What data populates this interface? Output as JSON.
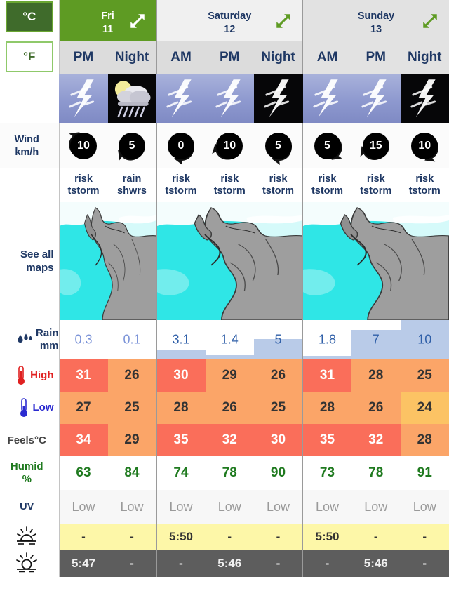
{
  "units": {
    "celsius": "°C",
    "fahrenheit": "°F",
    "selected": "°C"
  },
  "labels": {
    "wind": "Wind",
    "wind_unit": "km/h",
    "see_all": "See all",
    "maps": "maps",
    "rain": "Rain",
    "rain_unit": "mm",
    "high": "High",
    "low": "Low",
    "feels": "Feels°C",
    "humid": "Humid",
    "humid_unit": "%",
    "uv": "UV"
  },
  "days": [
    {
      "name": "Fri",
      "num": "11",
      "today": true,
      "periods": [
        "PM",
        "Night"
      ]
    },
    {
      "name": "Saturday",
      "num": "12",
      "today": false,
      "periods": [
        "AM",
        "PM",
        "Night"
      ]
    },
    {
      "name": "Sunday",
      "num": "13",
      "today": false,
      "periods": [
        "AM",
        "PM",
        "Night"
      ]
    }
  ],
  "columns": [
    {
      "day": 0,
      "period": "PM",
      "icon": "day-thunderstorm",
      "wind": "10",
      "wind_dir": 225,
      "risk": [
        "risk",
        "tstorm"
      ],
      "rain": "0.3",
      "rain_bar": 0,
      "high": "31",
      "high_class": "t-hot",
      "low": "27",
      "low_class": "t-warm",
      "feels": "34",
      "feels_class": "t-hot",
      "humid": "63",
      "uv": "Low",
      "sunrise": "-",
      "sunset": "5:47"
    },
    {
      "day": 0,
      "period": "Night",
      "icon": "night-rain",
      "wind": "5",
      "wind_dir": 135,
      "risk": [
        "rain",
        "shwrs"
      ],
      "rain": "0.1",
      "rain_bar": 0,
      "high": "26",
      "high_class": "t-warm",
      "low": "25",
      "low_class": "t-warm",
      "feels": "29",
      "feels_class": "t-warm",
      "humid": "84",
      "uv": "Low",
      "sunrise": "-",
      "sunset": "-"
    },
    {
      "day": 1,
      "period": "AM",
      "icon": "day-thunderstorm",
      "wind": "0",
      "wind_dir": 90,
      "risk": [
        "risk",
        "tstorm"
      ],
      "rain": "3.1",
      "rain_bar": 13,
      "high": "30",
      "high_class": "t-hot",
      "low": "28",
      "low_class": "t-warm",
      "feels": "35",
      "feels_class": "t-hot",
      "humid": "74",
      "uv": "Low",
      "sunrise": "5:50",
      "sunset": "-"
    },
    {
      "day": 1,
      "period": "PM",
      "icon": "day-thunderstorm",
      "wind": "10",
      "wind_dir": 160,
      "risk": [
        "risk",
        "tstorm"
      ],
      "rain": "1.4",
      "rain_bar": 6,
      "high": "29",
      "high_class": "t-warm",
      "low": "26",
      "low_class": "t-warm",
      "feels": "32",
      "feels_class": "t-hot",
      "humid": "78",
      "uv": "Low",
      "sunrise": "-",
      "sunset": "5:46"
    },
    {
      "day": 1,
      "period": "Night",
      "icon": "night-thunderstorm",
      "wind": "5",
      "wind_dir": 90,
      "risk": [
        "risk",
        "tstorm"
      ],
      "rain": "5",
      "rain_bar": 29,
      "high": "26",
      "high_class": "t-warm",
      "low": "25",
      "low_class": "t-warm",
      "feels": "30",
      "feels_class": "t-hot",
      "humid": "90",
      "uv": "Low",
      "sunrise": "-",
      "sunset": "-"
    },
    {
      "day": 2,
      "period": "AM",
      "icon": "day-thunderstorm",
      "wind": "5",
      "wind_dir": 45,
      "risk": [
        "risk",
        "tstorm"
      ],
      "rain": "1.8",
      "rain_bar": 5,
      "high": "31",
      "high_class": "t-hot",
      "low": "28",
      "low_class": "t-warm",
      "feels": "35",
      "feels_class": "t-hot",
      "humid": "73",
      "uv": "Low",
      "sunrise": "5:50",
      "sunset": "-"
    },
    {
      "day": 2,
      "period": "PM",
      "icon": "day-thunderstorm",
      "wind": "15",
      "wind_dir": 150,
      "risk": [
        "risk",
        "tstorm"
      ],
      "rain": "7",
      "rain_bar": 42,
      "high": "28",
      "high_class": "t-warm",
      "low": "26",
      "low_class": "t-warm",
      "feels": "32",
      "feels_class": "t-hot",
      "humid": "78",
      "uv": "Low",
      "sunrise": "-",
      "sunset": "5:46"
    },
    {
      "day": 2,
      "period": "Night",
      "icon": "night-thunderstorm",
      "wind": "10",
      "wind_dir": 60,
      "risk": [
        "risk",
        "tstorm"
      ],
      "rain": "10",
      "rain_bar": 56,
      "high": "25",
      "high_class": "t-warm",
      "low": "24",
      "low_class": "t-mid",
      "feels": "28",
      "feels_class": "t-warm",
      "humid": "91",
      "uv": "Low",
      "sunrise": "-",
      "sunset": "-"
    }
  ],
  "colors": {
    "today_green": "#5e9b23",
    "hot": "#fa6e5a",
    "warm": "#fba568",
    "mid": "#fcc364",
    "rain_bar": "#b9cbe8",
    "humid_green": "#1f7a1f",
    "sunrise_bg": "#fdf7a8",
    "sunset_bg": "#5d5d5d"
  }
}
